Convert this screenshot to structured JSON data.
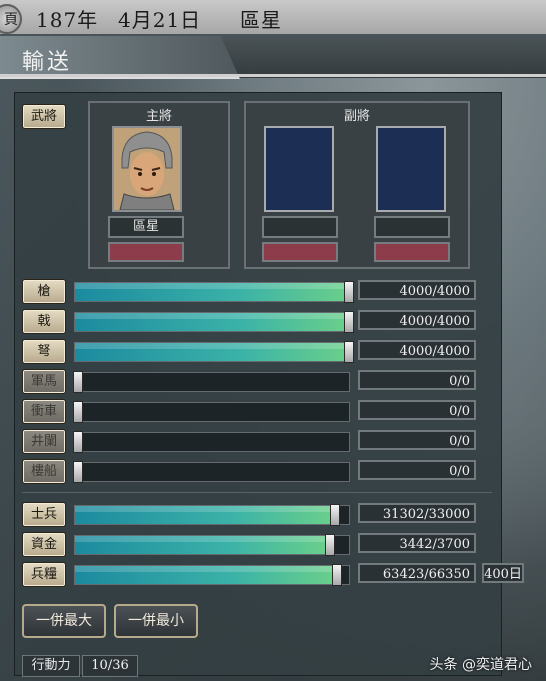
{
  "header": {
    "icon_glyph": "頁",
    "year": "187年",
    "date": "4月21日",
    "officer_name": "區星"
  },
  "screen_title": "輸送",
  "general_section": {
    "label": "武將",
    "main_label": "主將",
    "deputy_label": "副將",
    "main_name": "區星"
  },
  "resources": [
    {
      "label": "槍",
      "value": "4000/4000",
      "level": 1.0,
      "enabled": true
    },
    {
      "label": "戟",
      "value": "4000/4000",
      "level": 1.0,
      "enabled": true
    },
    {
      "label": "弩",
      "value": "4000/4000",
      "level": 1.0,
      "enabled": true
    },
    {
      "label": "軍馬",
      "value": "0/0",
      "level": 0.0,
      "enabled": false
    },
    {
      "label": "衝車",
      "value": "0/0",
      "level": 0.0,
      "enabled": false
    },
    {
      "label": "井闌",
      "value": "0/0",
      "level": 0.0,
      "enabled": false
    },
    {
      "label": "樓船",
      "value": "0/0",
      "level": 0.0,
      "enabled": false
    }
  ],
  "supplies": [
    {
      "label": "士兵",
      "value": "31302/33000",
      "level": 0.9485
    },
    {
      "label": "資金",
      "value": "3442/3700",
      "level": 0.9303
    },
    {
      "label": "兵糧",
      "value": "63423/66350",
      "level": 0.9559,
      "days": "400日"
    }
  ],
  "buttons": {
    "max_all": "一併最大",
    "min_all": "一併最小"
  },
  "action_power": {
    "label": "行動力",
    "value": "10/36"
  },
  "watermark": "头条 @奕道君心",
  "colors": {
    "bar_fill_start": "#1c8a9f",
    "bar_fill_end": "#6bd08a",
    "button_tan": "#d6c9ab",
    "deputy_slot": "#1d2e55",
    "red_slot": "#8c3c4a"
  }
}
